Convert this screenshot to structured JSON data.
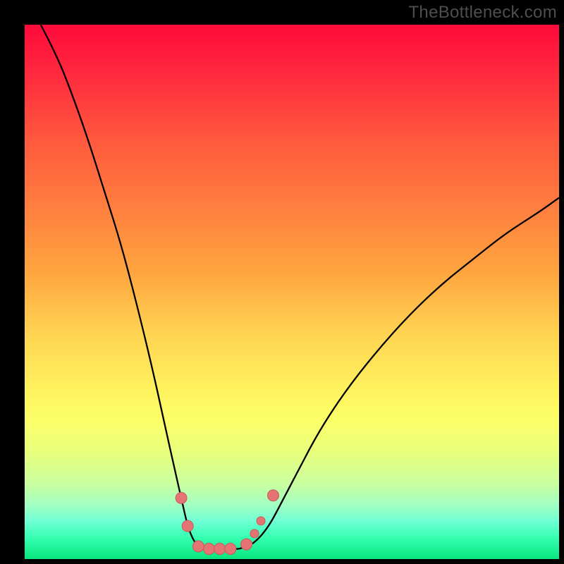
{
  "watermark": "TheBottleneck.com",
  "colors": {
    "curve": "#000000",
    "curve_width": 2.3,
    "marker_fill": "#e57373",
    "marker_stroke": "#c85a5a",
    "marker_radius": 8,
    "marker_radius_small": 6
  },
  "chart_data": {
    "type": "line",
    "title": "",
    "xlabel": "",
    "ylabel": "",
    "xlim": [
      0,
      100
    ],
    "ylim": [
      0,
      105
    ],
    "left_curve_xy": [
      [
        3,
        105
      ],
      [
        6,
        99
      ],
      [
        9,
        91
      ],
      [
        12,
        82
      ],
      [
        15,
        72
      ],
      [
        18,
        62
      ],
      [
        21,
        50
      ],
      [
        24,
        37
      ],
      [
        26.5,
        25
      ],
      [
        28,
        18
      ],
      [
        29.5,
        11
      ],
      [
        30.5,
        6.5
      ],
      [
        31.5,
        3.8
      ],
      [
        32.5,
        2.5
      ],
      [
        34,
        2.0
      ]
    ],
    "right_curve_xy": [
      [
        40,
        2.0
      ],
      [
        42,
        2.5
      ],
      [
        44,
        4.2
      ],
      [
        46,
        7
      ],
      [
        48,
        11
      ],
      [
        51,
        17
      ],
      [
        55,
        25
      ],
      [
        60,
        33
      ],
      [
        66,
        41
      ],
      [
        72,
        48
      ],
      [
        78,
        54
      ],
      [
        84,
        59
      ],
      [
        90,
        64
      ],
      [
        96,
        68
      ],
      [
        100,
        71
      ]
    ],
    "floor_segment": {
      "x0": 34,
      "x1": 40,
      "y": 2.0
    },
    "markers": [
      {
        "x": 29.3,
        "y": 12.0,
        "r": "normal"
      },
      {
        "x": 30.5,
        "y": 6.5,
        "r": "normal"
      },
      {
        "x": 32.5,
        "y": 2.5,
        "r": "normal"
      },
      {
        "x": 34.5,
        "y": 2.0,
        "r": "normal"
      },
      {
        "x": 36.5,
        "y": 2.0,
        "r": "normal"
      },
      {
        "x": 38.5,
        "y": 2.0,
        "r": "normal"
      },
      {
        "x": 41.5,
        "y": 2.9,
        "r": "normal"
      },
      {
        "x": 43.0,
        "y": 5.0,
        "r": "small"
      },
      {
        "x": 44.2,
        "y": 7.5,
        "r": "small"
      },
      {
        "x": 46.5,
        "y": 12.5,
        "r": "normal"
      }
    ]
  }
}
